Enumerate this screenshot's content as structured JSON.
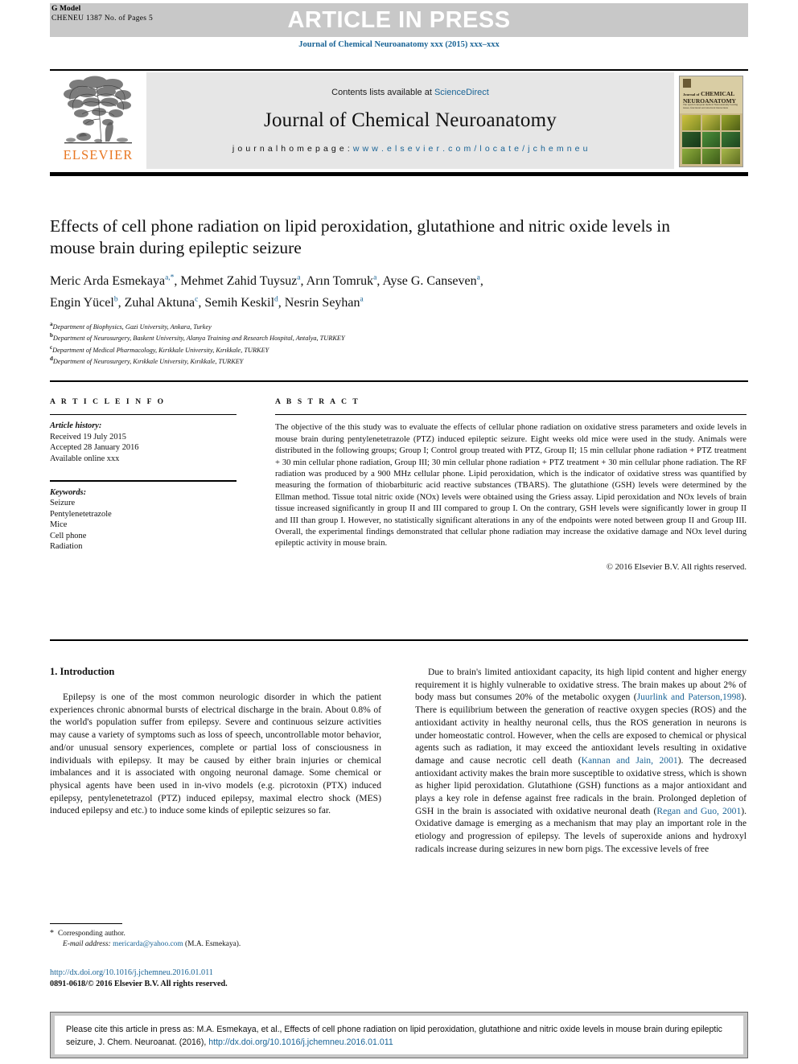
{
  "header": {
    "g_model": "G Model",
    "article_code": "CHENEU 1387 No. of Pages 5",
    "press_banner": "ARTICLE IN PRESS",
    "journal_ref": "Journal of Chemical Neuroanatomy xxx (2015) xxx–xxx"
  },
  "masthead": {
    "publisher": "ELSEVIER",
    "contents_prefix": "Contents lists available at ",
    "contents_link": "ScienceDirect",
    "journal_name": "Journal of Chemical Neuroanatomy",
    "homepage_label": "j o u r n a l   h o m e p a g e :   ",
    "homepage_url": "w w w . e l s e v i e r . c o m / l o c a t e / j c h e m n e u",
    "cover": {
      "line1": "Journal of",
      "line2": "CHEMICAL",
      "line3": "NEUROANATOMY",
      "subtitle": "The special european medical Neuroanatomy bearing issues, functional and structural interactions"
    }
  },
  "article": {
    "title": "Effects of cell phone radiation on lipid peroxidation, glutathione and nitric oxide levels in mouse brain during epileptic seizure",
    "authors": [
      {
        "name": "Meric Arda Esmekaya",
        "sup": "a,*"
      },
      {
        "name": "Mehmet Zahid Tuysuz",
        "sup": "a"
      },
      {
        "name": "Arın Tomruk",
        "sup": "a"
      },
      {
        "name": "Ayse G. Canseven",
        "sup": "a"
      },
      {
        "name": "Engin Yücel",
        "sup": "b"
      },
      {
        "name": "Zuhal Aktuna",
        "sup": "c"
      },
      {
        "name": "Semih Keskil",
        "sup": "d"
      },
      {
        "name": "Nesrin Seyhan",
        "sup": "a"
      }
    ],
    "affiliations": [
      {
        "label": "a",
        "text": "Department of Biophysics, Gazi University, Ankara, Turkey"
      },
      {
        "label": "b",
        "text": "Department of Neurosurgery, Baskent University, Alanya Training and Research Hospital, Antalya, TURKEY"
      },
      {
        "label": "c",
        "text": "Department of Medical Pharmacology, Kırıkkale University, Kırıkkale, TURKEY"
      },
      {
        "label": "d",
        "text": "Department of Neurosurgery, Kırıkkale University, Kırıkkale, TURKEY"
      }
    ]
  },
  "article_info": {
    "heading": "A R T I C L E   I N F O",
    "history_label": "Article history:",
    "received": "Received 19 July 2015",
    "accepted": "Accepted 28 January 2016",
    "available": "Available online xxx",
    "keywords_label": "Keywords:",
    "keywords": [
      "Seizure",
      "Pentylenetetrazole",
      "Mice",
      "Cell phone",
      "Radiation"
    ]
  },
  "abstract": {
    "heading": "A B S T R A C T",
    "text": "The objective of the this study was to evaluate the effects of cellular phone radiation on oxidative stress parameters and oxide levels in mouse brain during pentylenetetrazole (PTZ) induced epileptic seizure. Eight weeks old mice were used in the study. Animals were distributed in the following groups; Group I; Control group treated with PTZ, Group II; 15 min cellular phone radiation + PTZ treatment + 30 min cellular phone radiation, Group III; 30 min cellular phone radiation + PTZ treatment + 30 min cellular phone radiation. The RF radiation was produced by a 900 MHz cellular phone. Lipid peroxidation, which is the indicator of oxidative stress was quantified by measuring the formation of thiobarbituric acid reactive substances (TBARS). The glutathione (GSH) levels were determined by the Ellman method. Tissue total nitric oxide (NOx) levels were obtained using the Griess assay. Lipid peroxidation and NOx levels of brain tissue increased significantly in group II and III compared to group I. On the contrary, GSH levels were significantly lower in group II and III than group I. However, no statistically significant alterations in any of the endpoints were noted between group II and Group III. Overall, the experimental findings demonstrated that cellular phone radiation may increase the oxidative damage and NOx level during epileptic activity in mouse brain.",
    "copyright": "© 2016 Elsevier B.V. All rights reserved."
  },
  "body": {
    "section_title": "1. Introduction",
    "left_para": "Epilepsy is one of the most common neurologic disorder in which the patient experiences chronic abnormal bursts of electrical discharge in the brain. About 0.8% of the world's population suffer from epilepsy. Severe and continuous seizure activities may cause a variety of symptoms such as loss of speech, uncontrollable motor behavior, and/or unusual sensory experiences, complete or partial loss of consciousness in individuals with epilepsy. It may be caused by either brain injuries or chemical imbalances and it is associated with ongoing neuronal damage. Some chemical or physical agents have been used in in-vivo models (e.g. picrotoxin (PTX) induced epilepsy, pentylenetetrazol (PTZ) induced epilepsy, maximal electro shock (MES) induced epilepsy and etc.) to induce some kinds of epileptic seizures so far.",
    "right_seg1": "Due to brain's limited antioxidant capacity, its high lipid content and higher energy requirement it is highly vulnerable to oxidative stress. The brain makes up about 2% of body mass but consumes 20% of the metabolic oxygen (",
    "right_ref1": "Juurlink and Paterson,1998",
    "right_seg2": "). There is equilibrium between the generation of reactive oxygen species (ROS) and the antioxidant activity in healthy neuronal cells, thus the ROS generation in neurons is under homeostatic control. However, when the cells are exposed to chemical or physical agents such as radiation, it may exceed the antioxidant levels resulting in oxidative damage and cause necrotic cell death (",
    "right_ref2": "Kannan and Jain, 2001",
    "right_seg3": "). The decreased antioxidant activity makes the brain more susceptible to oxidative stress, which is shown as higher lipid peroxidation. Glutathione (GSH) functions as a major antioxidant and plays a key role in defense against free radicals in the brain. Prolonged depletion of GSH in the brain is associated with oxidative neuronal death (",
    "right_ref3": "Regan and Guo, 2001",
    "right_seg4": "). Oxidative damage is emerging as a mechanism that may play an important role in the etiology and progression of epilepsy. The levels of superoxide anions and hydroxyl radicals increase during seizures in new born pigs. The excessive levels of free"
  },
  "footnote": {
    "star": "*",
    "corresponding": "Corresponding author.",
    "email_label": "E-mail address:",
    "email": "mericarda@yahoo.com",
    "email_owner": "(M.A. Esmekaya)."
  },
  "doi_block": {
    "doi_url": "http://dx.doi.org/10.1016/j.jchemneu.2016.01.011",
    "issn_line": "0891-0618/© 2016 Elsevier B.V. All rights reserved."
  },
  "cite_box": {
    "text_before": "Please cite this article in press as: M.A. Esmekaya, et al., Effects of cell phone radiation on lipid peroxidation, glutathione and nitric oxide levels in mouse brain during epileptic seizure, J. Chem. Neuroanat. (2016), ",
    "doi": "http://dx.doi.org/10.1016/j.jchemneu.2016.01.011"
  },
  "colors": {
    "link": "#1a6496",
    "elsevier_orange": "#E87722",
    "banner_grey": "#c8c8c8",
    "masthead_grey": "#e6e6e6"
  }
}
